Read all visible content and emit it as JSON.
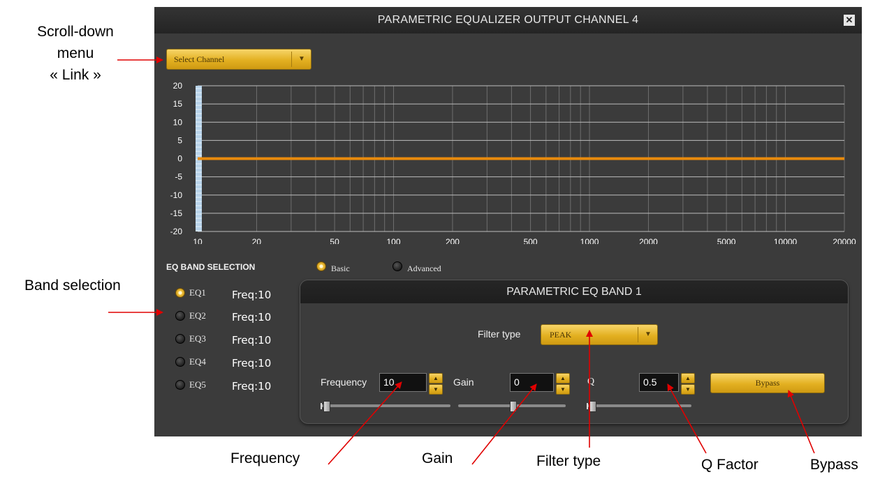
{
  "annotations": {
    "scroll_menu": "Scroll-down\nmenu\n« Link »",
    "band_selection": "Band selection",
    "frequency": "Frequency",
    "gain": "Gain",
    "filter_type": "Filter type",
    "q_factor": "Q Factor",
    "bypass": "Bypass"
  },
  "window": {
    "title": "PARAMETRIC EQUALIZER OUTPUT CHANNEL 4",
    "close_icon": "close-icon"
  },
  "channel_select": {
    "label": "Select Channel",
    "arrow": "▼"
  },
  "chart_data": {
    "type": "line",
    "x_scale": "log",
    "xlim": [
      10,
      20000
    ],
    "ylim": [
      -20,
      20
    ],
    "x_ticks": [
      "10",
      "20",
      "50",
      "100",
      "200",
      "500",
      "1000",
      "2000",
      "5000",
      "10000",
      "20000"
    ],
    "y_ticks": [
      "20",
      "15",
      "10",
      "5",
      "0",
      "-5",
      "-10",
      "-15",
      "-20"
    ],
    "grid": true,
    "series": [
      {
        "color": "#e88a0c",
        "points": [
          [
            10,
            0
          ],
          [
            20000,
            0
          ]
        ]
      }
    ],
    "band_marker_x": [
      10
    ]
  },
  "eq_band_selection": {
    "header": "EQ BAND SELECTION",
    "mode_basic": "Basic",
    "mode_advanced": "Advanced",
    "mode_selected": "Basic",
    "bands": [
      {
        "name": "EQ1",
        "freq": "Freq:10",
        "selected": true
      },
      {
        "name": "EQ2",
        "freq": "Freq:10",
        "selected": false
      },
      {
        "name": "EQ3",
        "freq": "Freq:10",
        "selected": false
      },
      {
        "name": "EQ4",
        "freq": "Freq:10",
        "selected": false
      },
      {
        "name": "EQ5",
        "freq": "Freq:10",
        "selected": false
      }
    ]
  },
  "band_panel": {
    "title": "PARAMETRIC EQ BAND 1",
    "filter_type_label": "Filter type",
    "filter_type_value": "PEAK",
    "frequency_label": "Frequency",
    "frequency_value": "10",
    "gain_label": "Gain",
    "gain_value": "0",
    "q_label": "Q",
    "q_value": "0.5",
    "bypass_label": "Bypass",
    "spin_up": "▲",
    "spin_down": "▼",
    "frequency_slider_fraction": 0.0,
    "gain_slider_fraction": 0.5,
    "q_slider_fraction": 0.0
  }
}
